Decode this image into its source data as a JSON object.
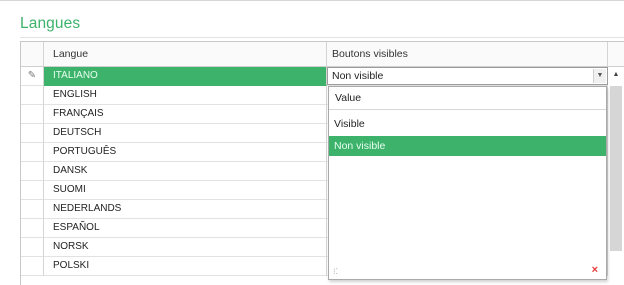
{
  "section": {
    "title": "Langues"
  },
  "grid": {
    "columns": {
      "language": "Langue",
      "visible_buttons": "Boutons visibles"
    },
    "editing_glyph": "✎",
    "selected_index": 0,
    "rows": [
      {
        "language": "ITALIANO"
      },
      {
        "language": "ENGLISH"
      },
      {
        "language": "FRANÇAIS"
      },
      {
        "language": "DEUTSCH"
      },
      {
        "language": "PORTUGUÊS"
      },
      {
        "language": "DANSK"
      },
      {
        "language": "SUOMI"
      },
      {
        "language": "NEDERLANDS"
      },
      {
        "language": "ESPAÑOL"
      },
      {
        "language": "NORSK"
      },
      {
        "language": "POLSKI"
      }
    ]
  },
  "editor": {
    "value": "Non visible",
    "dropdown_glyph": "▼"
  },
  "dropdown": {
    "header": "Value",
    "options": [
      "Visible",
      "Non visible"
    ],
    "selected": "Non visible",
    "grip_glyph": "⁝⁚",
    "close_glyph": "×"
  },
  "scrollbar": {
    "up_glyph": "▲"
  },
  "colors": {
    "accent": "#3db26b",
    "close": "#e53935"
  }
}
